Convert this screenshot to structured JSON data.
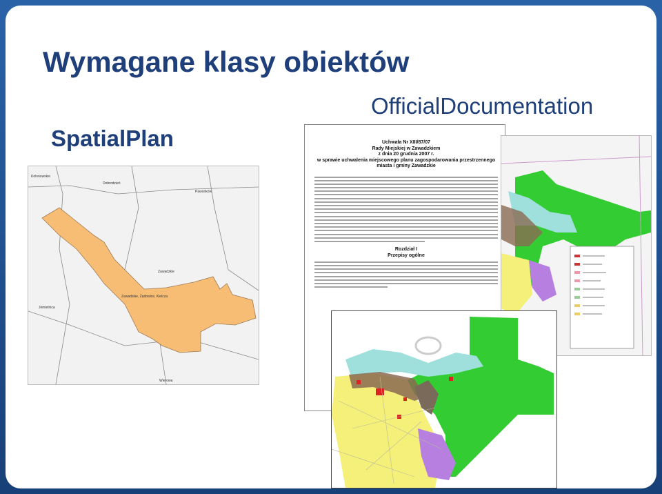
{
  "slide": {
    "title": "Wymagane klasy obiektów",
    "labels": {
      "spatial_plan": "SpatialPlan",
      "official_documentation": "OfficialDocumentation"
    }
  },
  "spatial_plan_map": {
    "place_names": [
      "Kolonowskie",
      "Dobrodzień",
      "Pawonków",
      "Zawadzkie",
      "Zawadzkie, Żędowice, Kielcza",
      "Jemielnica",
      "Wierowa"
    ],
    "region_color": "#f8bd74"
  },
  "official_document": {
    "heading_lines": [
      "Uchwała Nr XIII/87/07",
      "Rady Miejskiej w Zawadzkiem",
      "z dnia 20 grudnia 2007 r.",
      "w sprawie uchwalenia miejscowego planu zagospodarowania przestrzennego",
      "miasta i gminy Zawadzkie"
    ],
    "section_heading": [
      "Rozdział I",
      "Przepisy ogólne"
    ]
  },
  "colors": {
    "frame": "#1d4f91",
    "title_text": "#1f3f7a",
    "zone_green": "#33cc33",
    "zone_yellow": "#f5f07a",
    "zone_purple": "#b67fe0",
    "zone_cyan": "#9fe0dc",
    "zone_brown": "#8a6a52"
  },
  "icons": []
}
